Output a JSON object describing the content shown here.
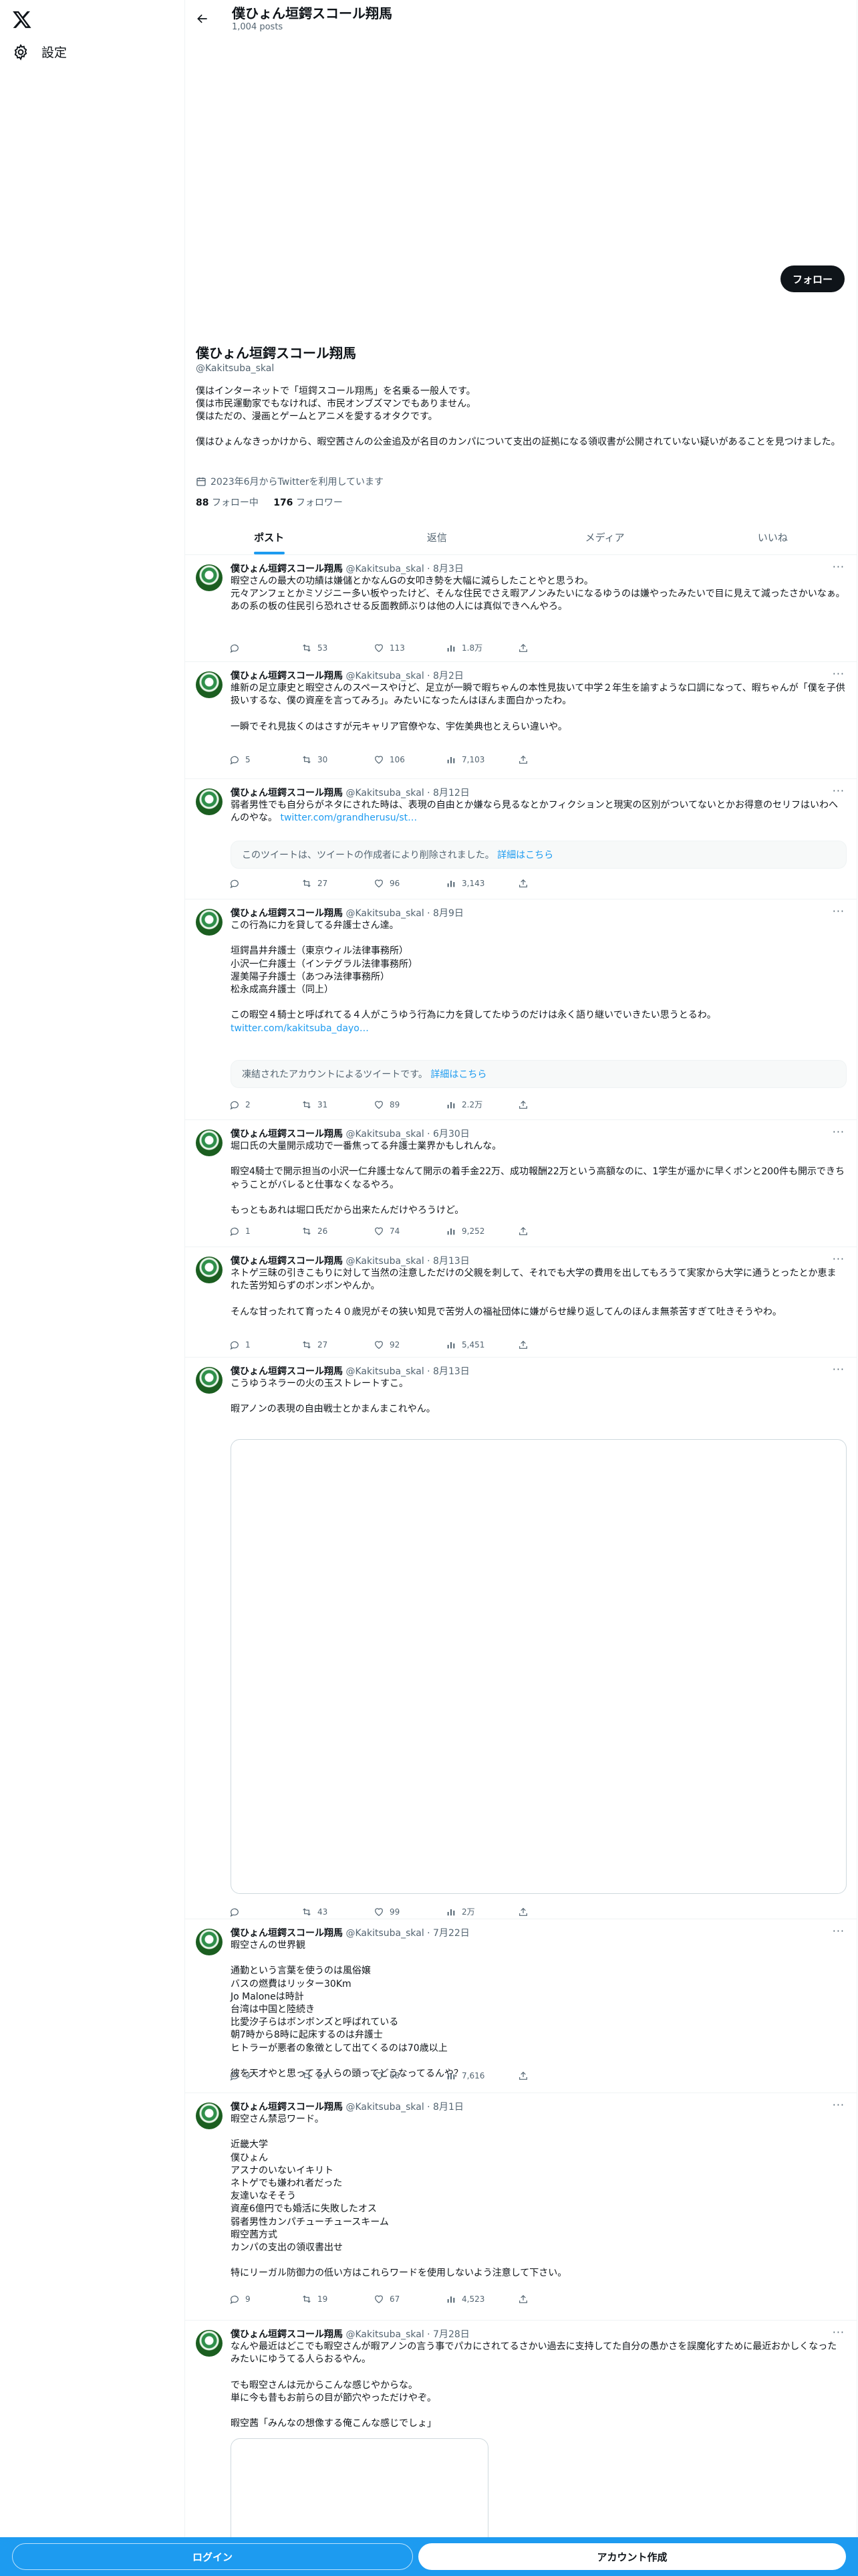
{
  "nav": {
    "settings_label": "設定"
  },
  "header": {
    "name": "僕ひょん垣鍔スコール翔馬",
    "posts_count": "1,004 posts"
  },
  "profile": {
    "follow_label": "フォロー",
    "name": "僕ひょん垣鍔スコール翔馬",
    "handle": "@Kakitsuba_skal",
    "bio": "僕はインターネットで「垣鍔スコール翔馬」を名乗る一般人です。\n僕は市民運動家でもなければ、市民オンブズマンでもありません。\n僕はただの、漫画とゲームとアニメを愛するオタクです。\n\n僕はひょんなきっかけから、暇空茜さんの公金追及が名目のカンパについて支出の証拠になる領収書が公開されていない疑いがあることを見つけました。",
    "joined": "2023年6月からTwitterを利用しています",
    "following_count": "88",
    "following_label": "フォロー中",
    "followers_count": "176",
    "followers_label": "フォロワー"
  },
  "tabs": [
    {
      "label": "ポスト"
    },
    {
      "label": "返信"
    },
    {
      "label": "メディア"
    },
    {
      "label": "いいね"
    }
  ],
  "tweets": [
    {
      "name": "僕ひょん垣鍔スコール翔馬",
      "meta": "@Kakitsuba_skal · 8月3日",
      "text": "暇空さんの最大の功績は嫌儲とかなんGの女叩き勢を大幅に減らしたことやと思うわ。\n元々アンフェとかミソジニー多い板やったけど、そんな住民でさえ暇アノンみたいになるゆうのは嫌やったみたいで目に見えて減ったさかいなぁ。\nあの系の板の住民引ら恐れさせる反面教師ぶりは他の人には真似できへんやろ。",
      "reply": "",
      "retweet": "53",
      "like": "113",
      "views": "1.8万"
    },
    {
      "name": "僕ひょん垣鍔スコール翔馬",
      "meta": "@Kakitsuba_skal · 8月2日",
      "text": "維新の足立康史と暇空さんのスペースやけど、足立が一瞬で暇ちゃんの本性見抜いて中学２年生を諭すような口調になって、暇ちゃんが「僕を子供扱いするな、僕の資産を言ってみろ」。みたいになったんはほんま面白かったわ。\n\n一瞬でそれ見抜くのはさすが元キャリア官僚やな、宇佐美典也とえらい違いや。",
      "reply": "5",
      "retweet": "30",
      "like": "106",
      "views": "7,103"
    },
    {
      "name": "僕ひょん垣鍔スコール翔馬",
      "meta": "@Kakitsuba_skal · 8月12日",
      "text": "弱者男性でも自分らがネタにされた時は、表現の自由とか嫌なら見るなとかフィクションと現実の区別がついてないとかお得意のセリフはいわへんのやな。",
      "link": "twitter.com/grandherusu/st…",
      "quote": "このツイートは、ツイートの作成者により削除されました。",
      "quote_link": "詳細はこちら",
      "reply": "",
      "retweet": "27",
      "like": "96",
      "views": "3,143"
    },
    {
      "name": "僕ひょん垣鍔スコール翔馬",
      "meta": "@Kakitsuba_skal · 8月9日",
      "text": "この行為に力を貸してる弁護士さん達。\n\n垣鍔昌井弁護士（東京ウィル法律事務所）\n小沢一仁弁護士（インテグラル法律事務所）\n渥美陽子弁護士（あつみ法律事務所）\n松永成高弁護士（同上）\n\nこの暇空４騎士と呼ばれてる４人がこうゆう行為に力を貸してたゆうのだけは永く語り継いでいきたい思うとるわ。",
      "link": "twitter.com/kakitsuba_dayo…",
      "quote": "凍結されたアカウントによるツイートです。",
      "quote_link": "詳細はこちら",
      "reply": "2",
      "retweet": "31",
      "like": "89",
      "views": "2.2万"
    },
    {
      "name": "僕ひょん垣鍔スコール翔馬",
      "meta": "@Kakitsuba_skal · 6月30日",
      "text": "堀口氏の大量開示成功で一番焦ってる弁護士業界かもしれんな。\n\n暇空4騎士で開示担当の小沢一仁弁護士なんて開示の着手金22万、成功報酬22万という高額なのに、1学生が遥かに早くポンと200件も開示できちゃうことがバレると仕事なくなるやろ。\n\nもっともあれは堀口氏だから出来たんだけやろうけど。",
      "reply": "1",
      "retweet": "26",
      "like": "74",
      "views": "9,252"
    },
    {
      "name": "僕ひょん垣鍔スコール翔馬",
      "meta": "@Kakitsuba_skal · 8月13日",
      "text": "ネトゲ三昧の引きこもりに対して当然の注意しただけの父親を刺して、それでも大学の費用を出してもろうて実家から大学に通うとったとか恵まれた苦労知らずのボンボンやんか。\n\nそんな甘ったれて育った４０歳児がその狭い知見で苦労人の福祉団体に嫌がらせ繰り返してんのほんま無茶苦すぎて吐きそうやわ。",
      "reply": "1",
      "retweet": "27",
      "like": "92",
      "views": "5,451"
    },
    {
      "name": "僕ひょん垣鍔スコール翔馬",
      "meta": "@Kakitsuba_skal · 8月13日",
      "text": "こうゆうネラーの火の玉ストレートすこ。\n\n暇アノンの表現の自由戦士とかまんまこれやん。",
      "reply": "",
      "retweet": "43",
      "like": "99",
      "views": "2万"
    },
    {
      "name": "僕ひょん垣鍔スコール翔馬",
      "meta": "@Kakitsuba_skal · 7月22日",
      "text": "暇空さんの世界観\n\n通勤という言葉を使うのは風俗嬢\nバスの燃費はリッター30Km\nJo Maloneは時計\n台湾は中国と陸続き\n比愛汐子らはボンボンズと呼ばれている\n朝7時から8時に起床するのは弁護士\nヒトラーが悪者の象徴として出てくるのは70歳以上\n\n彼を天才やと思ってる人らの頭ってどうなってるんや？",
      "reply": "3",
      "retweet": "23",
      "like": "68",
      "views": "7,616"
    },
    {
      "name": "僕ひょん垣鍔スコール翔馬",
      "meta": "@Kakitsuba_skal · 8月1日",
      "text": "暇空さん禁忌ワード。\n\n近畿大学\n僕ひょん\nアスナのいないイキリト\nネトゲでも嫌われ者だった\n友達いなそそう\n資産6億円でも婚活に失敗したオス\n弱者男性カンパチューチュースキーム\n暇空茜方式\nカンパの支出の領収書出せ\n\n特にリーガル防御力の低い方はこれらワードを使用しないよう注意して下さい。",
      "reply": "9",
      "retweet": "19",
      "like": "67",
      "views": "4,523"
    },
    {
      "name": "僕ひょん垣鍔スコール翔馬",
      "meta": "@Kakitsuba_skal · 7月28日",
      "text": "なんや最近はどこでも暇空さんが暇アノンの言う事でパカにされてるさかい過去に支持してた自分の愚かさを誤魔化すために最近おかしくなったみたいにゆうてる人らおるやん。\n\nでも暇空さんは元からこんな感じやからな。\n単に今も昔もお前らの目が節穴やっただけやぞ。\n\n暇空茜「みんなの想像する俺こんな感じでしょ」",
      "reply": "",
      "retweet": "",
      "like": "",
      "views": ""
    }
  ],
  "bottom": {
    "login_label": "ログイン",
    "signup_label": "アカウント作成"
  }
}
